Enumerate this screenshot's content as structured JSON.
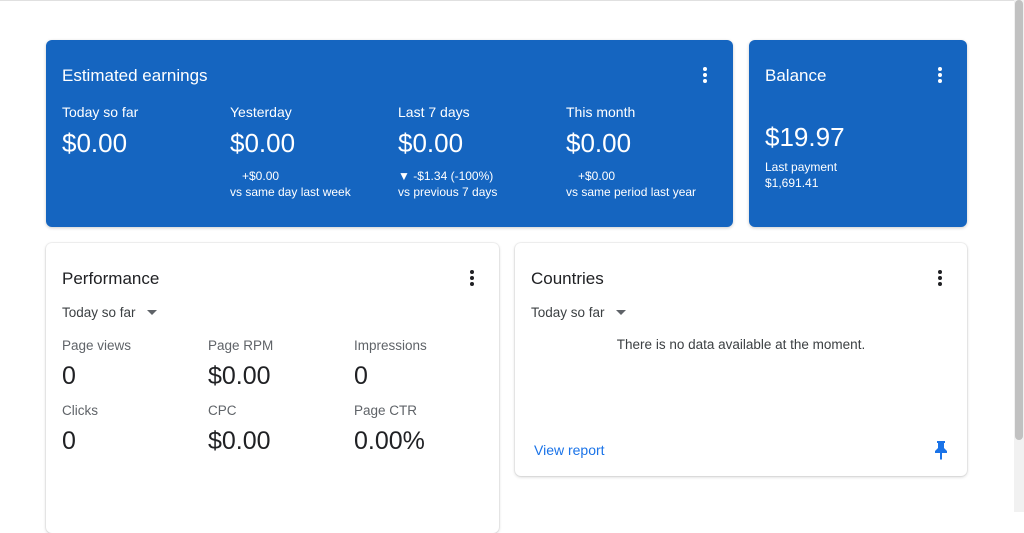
{
  "earnings": {
    "title": "Estimated earnings",
    "periods": [
      {
        "label": "Today so far",
        "value": "$0.00",
        "delta": "",
        "compare": ""
      },
      {
        "label": "Yesterday",
        "value": "$0.00",
        "delta": "+$0.00",
        "compare": "vs same day last week"
      },
      {
        "label": "Last 7 days",
        "value": "$0.00",
        "delta": "▼ -$1.34 (-100%)",
        "compare": "vs previous 7 days"
      },
      {
        "label": "This month",
        "value": "$0.00",
        "delta": "+$0.00",
        "compare": "vs same period last year"
      }
    ]
  },
  "balance": {
    "title": "Balance",
    "value": "$19.97",
    "last_payment_label": "Last payment",
    "last_payment_value": "$1,691.41"
  },
  "performance": {
    "title": "Performance",
    "range": "Today so far",
    "metrics": [
      {
        "label": "Page views",
        "value": "0"
      },
      {
        "label": "Page RPM",
        "value": "$0.00"
      },
      {
        "label": "Impressions",
        "value": "0"
      },
      {
        "label": "Clicks",
        "value": "0"
      },
      {
        "label": "CPC",
        "value": "$0.00"
      },
      {
        "label": "Page CTR",
        "value": "0.00%"
      }
    ]
  },
  "countries": {
    "title": "Countries",
    "range": "Today so far",
    "empty_message": "There is no data available at the moment.",
    "view_report": "View report"
  },
  "colors": {
    "card_blue": "#1565c0",
    "link_blue": "#1a73e8"
  },
  "icons": {
    "menu": "more-vert-icon",
    "dropdown": "arrow-drop-down-icon",
    "pin": "pin-icon"
  }
}
